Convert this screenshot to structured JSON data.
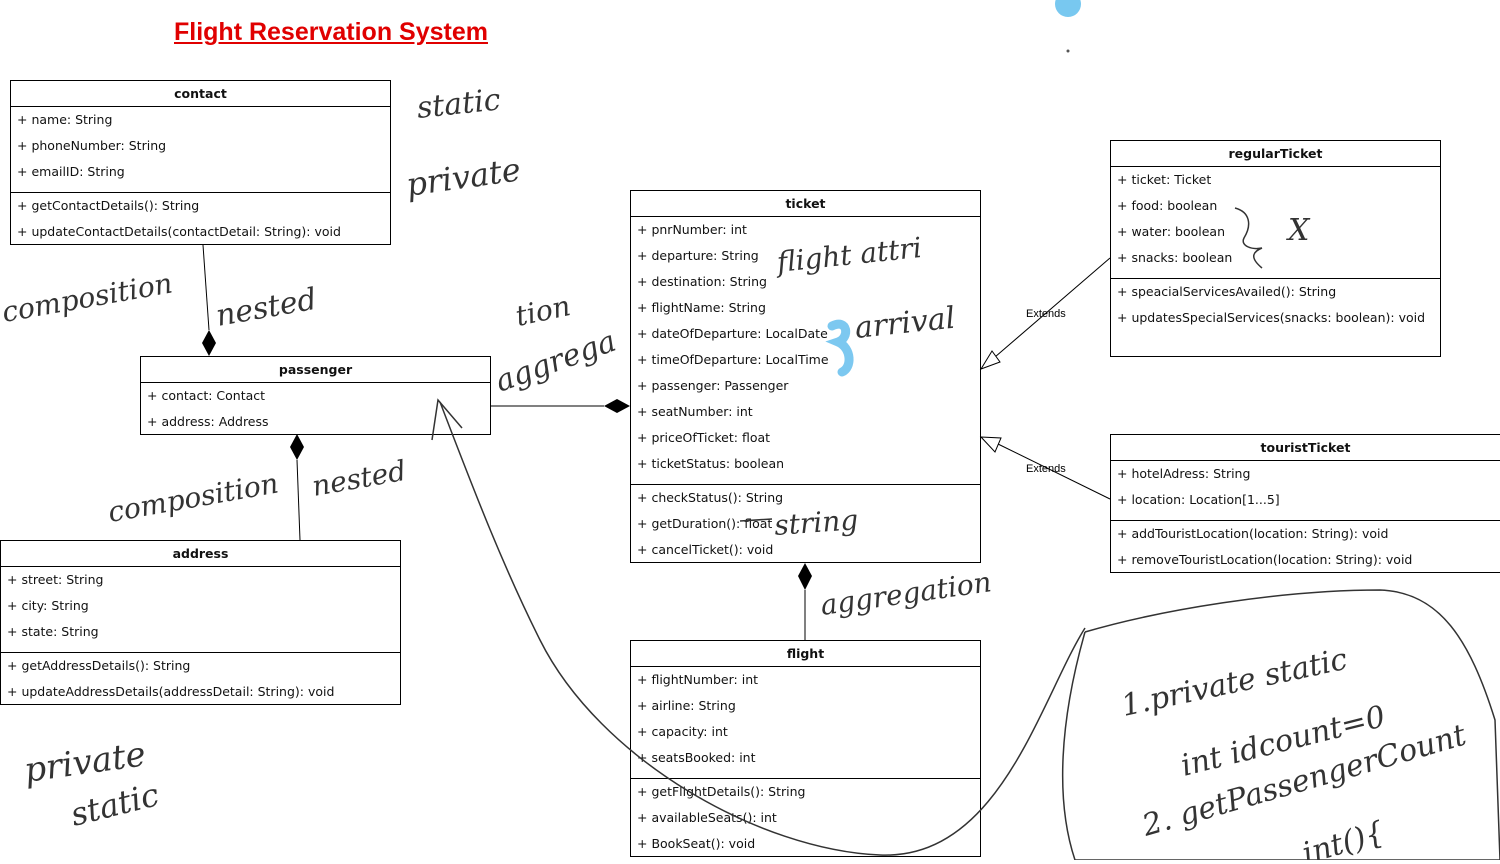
{
  "title": "Flight Reservation System",
  "classes": {
    "contact": {
      "name": "contact",
      "attributes": [
        "+ name: String",
        "+ phoneNumber: String",
        "+ emailID: String"
      ],
      "methods": [
        "+ getContactDetails(): String",
        "+ updateContactDetails(contactDetail: String): void"
      ]
    },
    "passenger": {
      "name": "passenger",
      "attributes": [
        "+ contact: Contact",
        "+ address: Address"
      ],
      "methods": []
    },
    "address": {
      "name": "address",
      "attributes": [
        "+ street: String",
        "+ city: String",
        "+ state: String"
      ],
      "methods": [
        "+ getAddressDetails(): String",
        "+ updateAddressDetails(addressDetail: String): void"
      ]
    },
    "ticket": {
      "name": "ticket",
      "attributes": [
        "+ pnrNumber: int",
        "+ departure: String",
        "+ destination: String",
        "+ flightName: String",
        "+ dateOfDeparture: LocalDate",
        "+ timeOfDeparture: LocalTime",
        "+ passenger: Passenger",
        "+ seatNumber: int",
        "+ priceOfTicket: float",
        "+ ticketStatus: boolean"
      ],
      "methods": [
        "+ checkStatus(): String",
        "+ getDuration(): float",
        "+ cancelTicket(): void"
      ]
    },
    "flight": {
      "name": "flight",
      "attributes": [
        "+ flightNumber: int",
        "+ airline: String",
        "+ capacity: int",
        "+ seatsBooked: int"
      ],
      "methods": [
        "+ getFlightDetails(): String",
        "+ availableSeats(): int",
        "+ BookSeat(): void"
      ]
    },
    "regularTicket": {
      "name": "regularTicket",
      "attributes": [
        "+ ticket: Ticket",
        "+ food: boolean",
        "+ water: boolean",
        "+ snacks: boolean"
      ],
      "methods": [
        "+ speacialServicesAvailed(): String",
        "+ updatesSpecialServices(snacks: boolean): void"
      ]
    },
    "touristTicket": {
      "name": "touristTicket",
      "attributes": [
        "+ hotelAdress: String",
        "+ location: Location[1...5]"
      ],
      "methods": [
        "+ addTouristLocation(location: String): void",
        "+ removeTouristLocation(location: String): void"
      ]
    }
  },
  "relations": {
    "extends_label": "Extends"
  },
  "annotations": {
    "static_1": "static",
    "private_1": "private",
    "composition_1": "composition",
    "nested_1": "nested",
    "tion": "tion",
    "aggrega": "aggrega",
    "composition_2": "composition",
    "nested_2": "nested",
    "flight_attri": "flight attri",
    "arrival": "arrival",
    "string": "string",
    "aggregation": "aggregation",
    "x_mark": "X",
    "private_2": "private",
    "static_2": "static",
    "note_line1": "1.private static",
    "note_line2": "int idcount=0",
    "note_line3": "2. getPassengerCount",
    "note_line4": "int(){"
  }
}
